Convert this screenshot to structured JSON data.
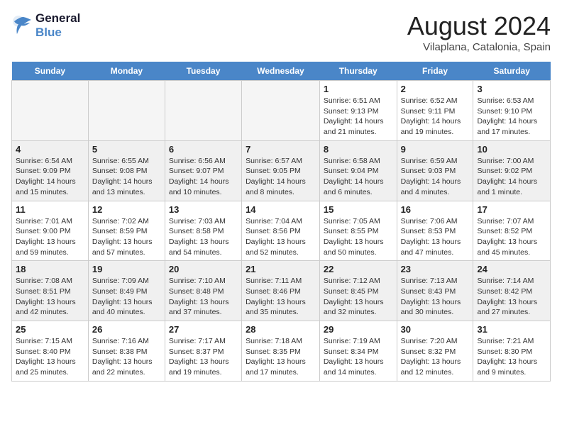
{
  "header": {
    "logo_line1": "General",
    "logo_line2": "Blue",
    "month_title": "August 2024",
    "location": "Vilaplana, Catalonia, Spain"
  },
  "weekdays": [
    "Sunday",
    "Monday",
    "Tuesday",
    "Wednesday",
    "Thursday",
    "Friday",
    "Saturday"
  ],
  "weeks": [
    [
      {
        "day": "",
        "empty": true
      },
      {
        "day": "",
        "empty": true
      },
      {
        "day": "",
        "empty": true
      },
      {
        "day": "",
        "empty": true
      },
      {
        "day": "1",
        "info": "Sunrise: 6:51 AM\nSunset: 9:13 PM\nDaylight: 14 hours\nand 21 minutes."
      },
      {
        "day": "2",
        "info": "Sunrise: 6:52 AM\nSunset: 9:11 PM\nDaylight: 14 hours\nand 19 minutes."
      },
      {
        "day": "3",
        "info": "Sunrise: 6:53 AM\nSunset: 9:10 PM\nDaylight: 14 hours\nand 17 minutes."
      }
    ],
    [
      {
        "day": "4",
        "info": "Sunrise: 6:54 AM\nSunset: 9:09 PM\nDaylight: 14 hours\nand 15 minutes."
      },
      {
        "day": "5",
        "info": "Sunrise: 6:55 AM\nSunset: 9:08 PM\nDaylight: 14 hours\nand 13 minutes."
      },
      {
        "day": "6",
        "info": "Sunrise: 6:56 AM\nSunset: 9:07 PM\nDaylight: 14 hours\nand 10 minutes."
      },
      {
        "day": "7",
        "info": "Sunrise: 6:57 AM\nSunset: 9:05 PM\nDaylight: 14 hours\nand 8 minutes."
      },
      {
        "day": "8",
        "info": "Sunrise: 6:58 AM\nSunset: 9:04 PM\nDaylight: 14 hours\nand 6 minutes."
      },
      {
        "day": "9",
        "info": "Sunrise: 6:59 AM\nSunset: 9:03 PM\nDaylight: 14 hours\nand 4 minutes."
      },
      {
        "day": "10",
        "info": "Sunrise: 7:00 AM\nSunset: 9:02 PM\nDaylight: 14 hours\nand 1 minute."
      }
    ],
    [
      {
        "day": "11",
        "info": "Sunrise: 7:01 AM\nSunset: 9:00 PM\nDaylight: 13 hours\nand 59 minutes."
      },
      {
        "day": "12",
        "info": "Sunrise: 7:02 AM\nSunset: 8:59 PM\nDaylight: 13 hours\nand 57 minutes."
      },
      {
        "day": "13",
        "info": "Sunrise: 7:03 AM\nSunset: 8:58 PM\nDaylight: 13 hours\nand 54 minutes."
      },
      {
        "day": "14",
        "info": "Sunrise: 7:04 AM\nSunset: 8:56 PM\nDaylight: 13 hours\nand 52 minutes."
      },
      {
        "day": "15",
        "info": "Sunrise: 7:05 AM\nSunset: 8:55 PM\nDaylight: 13 hours\nand 50 minutes."
      },
      {
        "day": "16",
        "info": "Sunrise: 7:06 AM\nSunset: 8:53 PM\nDaylight: 13 hours\nand 47 minutes."
      },
      {
        "day": "17",
        "info": "Sunrise: 7:07 AM\nSunset: 8:52 PM\nDaylight: 13 hours\nand 45 minutes."
      }
    ],
    [
      {
        "day": "18",
        "info": "Sunrise: 7:08 AM\nSunset: 8:51 PM\nDaylight: 13 hours\nand 42 minutes."
      },
      {
        "day": "19",
        "info": "Sunrise: 7:09 AM\nSunset: 8:49 PM\nDaylight: 13 hours\nand 40 minutes."
      },
      {
        "day": "20",
        "info": "Sunrise: 7:10 AM\nSunset: 8:48 PM\nDaylight: 13 hours\nand 37 minutes."
      },
      {
        "day": "21",
        "info": "Sunrise: 7:11 AM\nSunset: 8:46 PM\nDaylight: 13 hours\nand 35 minutes."
      },
      {
        "day": "22",
        "info": "Sunrise: 7:12 AM\nSunset: 8:45 PM\nDaylight: 13 hours\nand 32 minutes."
      },
      {
        "day": "23",
        "info": "Sunrise: 7:13 AM\nSunset: 8:43 PM\nDaylight: 13 hours\nand 30 minutes."
      },
      {
        "day": "24",
        "info": "Sunrise: 7:14 AM\nSunset: 8:42 PM\nDaylight: 13 hours\nand 27 minutes."
      }
    ],
    [
      {
        "day": "25",
        "info": "Sunrise: 7:15 AM\nSunset: 8:40 PM\nDaylight: 13 hours\nand 25 minutes."
      },
      {
        "day": "26",
        "info": "Sunrise: 7:16 AM\nSunset: 8:38 PM\nDaylight: 13 hours\nand 22 minutes."
      },
      {
        "day": "27",
        "info": "Sunrise: 7:17 AM\nSunset: 8:37 PM\nDaylight: 13 hours\nand 19 minutes."
      },
      {
        "day": "28",
        "info": "Sunrise: 7:18 AM\nSunset: 8:35 PM\nDaylight: 13 hours\nand 17 minutes."
      },
      {
        "day": "29",
        "info": "Sunrise: 7:19 AM\nSunset: 8:34 PM\nDaylight: 13 hours\nand 14 minutes."
      },
      {
        "day": "30",
        "info": "Sunrise: 7:20 AM\nSunset: 8:32 PM\nDaylight: 13 hours\nand 12 minutes."
      },
      {
        "day": "31",
        "info": "Sunrise: 7:21 AM\nSunset: 8:30 PM\nDaylight: 13 hours\nand 9 minutes."
      }
    ]
  ]
}
